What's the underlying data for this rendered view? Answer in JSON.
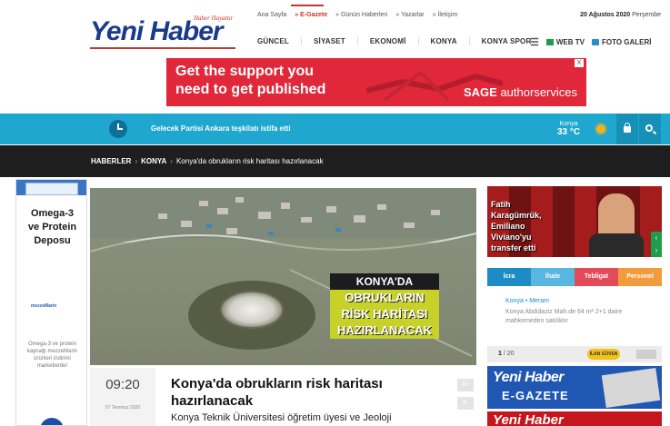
{
  "logo": {
    "name": "Yeni Haber",
    "tagline": "Haber Hayattır"
  },
  "topnav": [
    "Ana Sayfa",
    "» E-Gazete",
    "» Günün Haberleri",
    "» Yazarlar",
    "» İletişim"
  ],
  "date": {
    "day": "20 Ağustos 2020",
    "weekday": "Perşembe"
  },
  "mainnav": [
    "GÜNCEL",
    "SİYASET",
    "EKONOMİ",
    "KONYA",
    "KONYA SPOR"
  ],
  "rightnav": {
    "webtv": "WEB TV",
    "gallery": "FOTO GALERİ"
  },
  "ad": {
    "line1": "Get the support you",
    "line2": "need to get published",
    "brand_bold": "SAGE",
    "brand_rest": " authorservices",
    "close": "X"
  },
  "ticker": {
    "headline": "Gelecek Partisi Ankara teşkilatı istifa etti",
    "city": "Konya",
    "temp": "33 °C"
  },
  "breadcrumb": {
    "root": "HABERLER",
    "section": "KONYA",
    "current": "Konya'da obrukların risk haritası hazırlanacak"
  },
  "left_ad": {
    "title": "Omega-3 ve Protein Deposu",
    "brand": "mezzeMarin",
    "small": "Omega-3 ve protein kaynağı mezzeMarin ürünleri indirimi marketlerde!"
  },
  "photo_label": {
    "l1": "KONYA'DA",
    "l2": "OBRUKLARIN",
    "l3": "RİSK HARİTASI",
    "l4": "HAZIRLANACAK"
  },
  "article": {
    "time": "09:20",
    "date": "07 Temmuz 2020",
    "title": "Konya'da obrukların risk haritası hazırlanacak",
    "subtitle": "Konya Teknik Üniversitesi öğretim üyesi ve Jeoloji",
    "font_plus": "A+",
    "font_minus": "A-"
  },
  "right": {
    "video_caption": "Fatih Karagümrük, Emiliano Viviano'yu transfer etti",
    "tabs": [
      {
        "label": "İcra",
        "color": "#1e8cc4"
      },
      {
        "label": "İhale",
        "color": "#58b7e0"
      },
      {
        "label": "Tebligat",
        "color": "#e24b5a"
      },
      {
        "label": "Personel",
        "color": "#f19b3c"
      }
    ],
    "note_city": "Konya",
    "note_district": "• Meram",
    "note_desc": "Konya Abdülaziz Mah.de 64 m² 2+1 daire mahkemeden satılıktır",
    "gallery_current": "1",
    "gallery_total": " / 20",
    "gallery_tag": "İLAN GÜVEN",
    "egazete_title": "Yeni Haber",
    "egazete_sub": "E-GAZETE"
  }
}
